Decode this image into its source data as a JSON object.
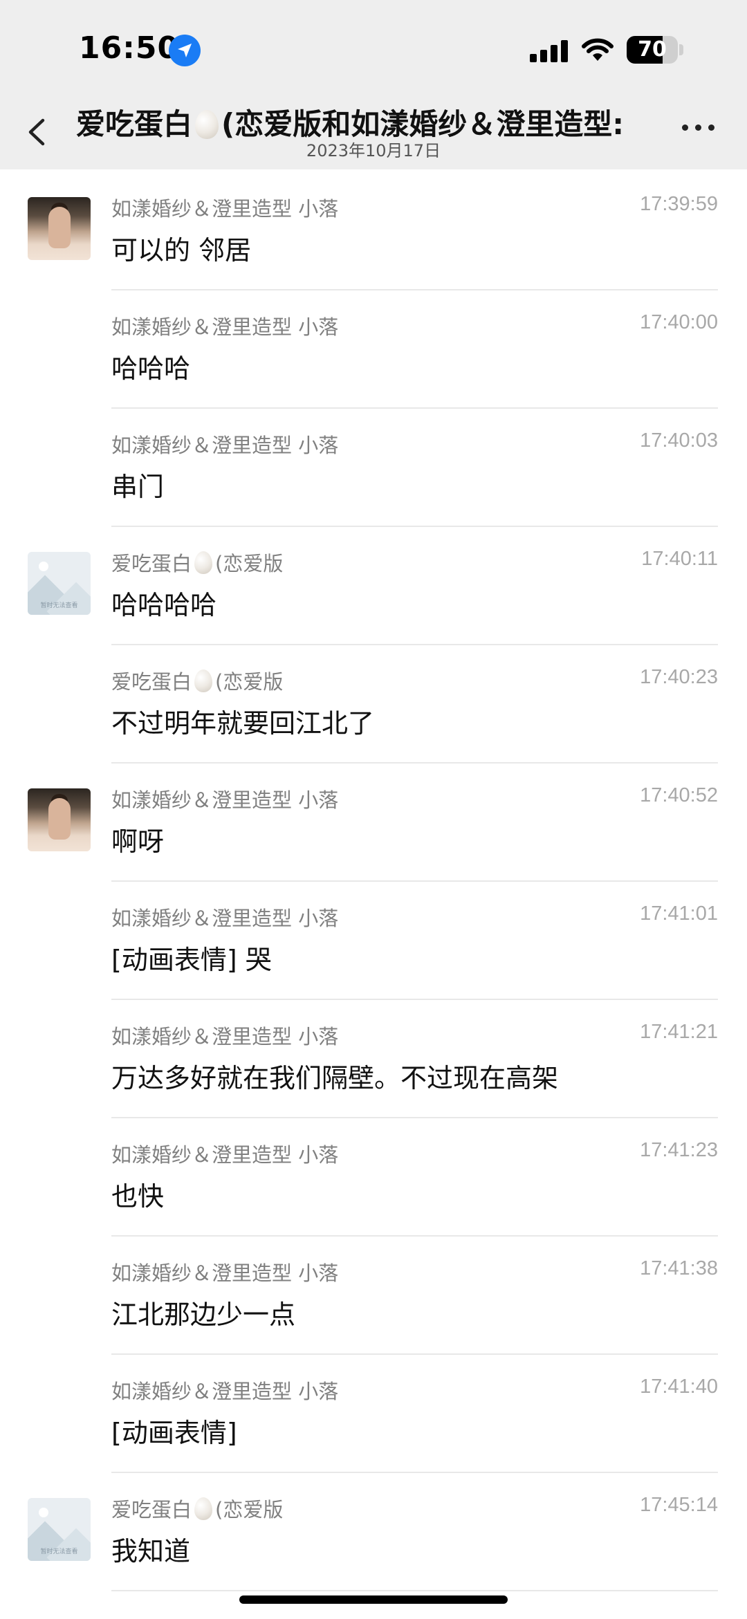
{
  "status": {
    "time": "16:50",
    "battery": "70",
    "battery_level": 0.7
  },
  "header": {
    "title_part1": "爱吃蛋白",
    "title_part2": "(恋爱版和如漾婚纱＆澄里造型:",
    "date": "2023年10月17日"
  },
  "avatars": {
    "placeholder_text": "暂时无法查看"
  },
  "messages": [
    {
      "sender": "如漾婚纱＆澄里造型 小落",
      "time": "17:39:59",
      "text": "可以的 邻居",
      "avatar": "photo"
    },
    {
      "sender": "如漾婚纱＆澄里造型 小落",
      "time": "17:40:00",
      "text": "哈哈哈",
      "avatar": "none"
    },
    {
      "sender": "如漾婚纱＆澄里造型 小落",
      "time": "17:40:03",
      "text": "串门",
      "avatar": "none"
    },
    {
      "sender_part1": "爱吃蛋白",
      "sender_part2": "(恋爱版",
      "time": "17:40:11",
      "text": "哈哈哈哈",
      "avatar": "placeholder"
    },
    {
      "sender_part1": "爱吃蛋白",
      "sender_part2": "(恋爱版",
      "time": "17:40:23",
      "text": "不过明年就要回江北了",
      "avatar": "none"
    },
    {
      "sender": "如漾婚纱＆澄里造型 小落",
      "time": "17:40:52",
      "text": "啊呀",
      "avatar": "photo"
    },
    {
      "sender": "如漾婚纱＆澄里造型 小落",
      "time": "17:41:01",
      "text": "[动画表情] 哭",
      "avatar": "none"
    },
    {
      "sender": "如漾婚纱＆澄里造型 小落",
      "time": "17:41:21",
      "text": "万达多好就在我们隔壁。不过现在高架",
      "avatar": "none"
    },
    {
      "sender": "如漾婚纱＆澄里造型 小落",
      "time": "17:41:23",
      "text": "也快",
      "avatar": "none"
    },
    {
      "sender": "如漾婚纱＆澄里造型 小落",
      "time": "17:41:38",
      "text": "江北那边少一点",
      "avatar": "none"
    },
    {
      "sender": "如漾婚纱＆澄里造型 小落",
      "time": "17:41:40",
      "text": "[动画表情]",
      "avatar": "none"
    },
    {
      "sender_part1": "爱吃蛋白",
      "sender_part2": "(恋爱版",
      "time": "17:45:14",
      "text": "我知道",
      "avatar": "placeholder"
    }
  ],
  "icons": {
    "location": "location-arrow-icon",
    "signal": "cellular-signal-icon",
    "wifi": "wifi-icon",
    "back": "chevron-left-icon",
    "more": "more-dots-icon",
    "egg": "egg-emoji-icon"
  },
  "colors": {
    "header_bg": "#eeeeee",
    "location_blue": "#1a7cf5",
    "sender_gray": "#808080",
    "time_gray": "#a8a8a8"
  }
}
